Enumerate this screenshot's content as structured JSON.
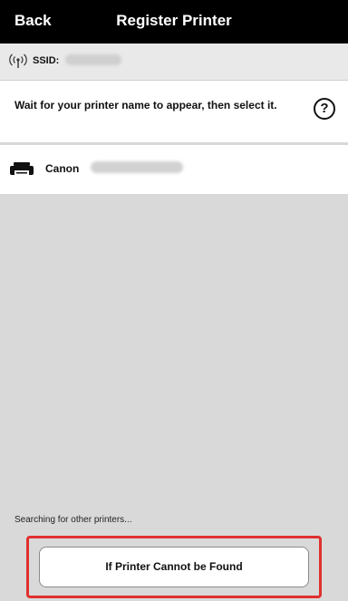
{
  "header": {
    "back_label": "Back",
    "title": "Register Printer"
  },
  "network": {
    "ssid_label": "SSID:",
    "wifi_icon": "wifi-icon"
  },
  "instruction": {
    "text": "Wait for your printer name to appear, then select it.",
    "help_icon": "help-icon",
    "help_symbol": "?"
  },
  "printer_list": {
    "items": [
      {
        "name": "Canon",
        "icon": "printer-icon"
      }
    ]
  },
  "status": {
    "searching_text": "Searching for other printers..."
  },
  "actions": {
    "cannot_found_label": "If Printer Cannot be Found"
  },
  "colors": {
    "header_background": "#000000",
    "page_background": "#d9d9d9",
    "highlight": "#e0302f"
  }
}
